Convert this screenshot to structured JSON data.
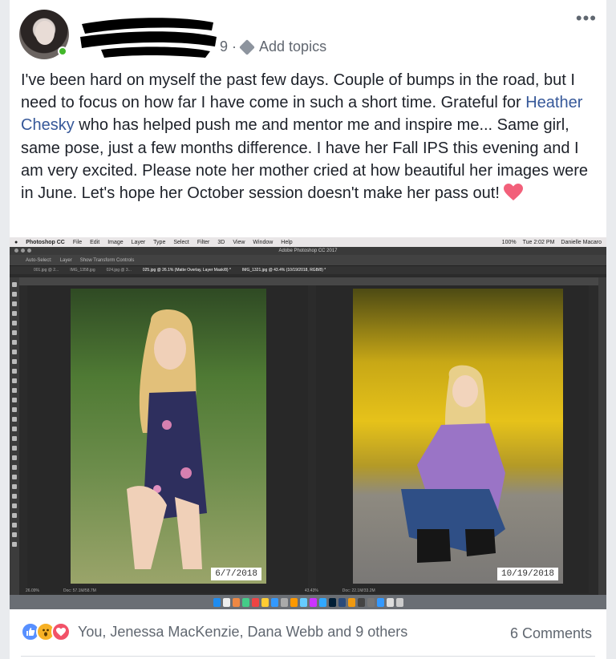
{
  "post": {
    "meta_fragment": "9 ·",
    "add_topics": "Add topics",
    "more": "•••",
    "text_1": "I've been hard on myself the past few days. Couple of bumps in the road, but I need to focus on how far I have come in such a short time. Grateful for ",
    "mention": "Heather Chesky",
    "text_2": " who has helped push me and mentor me and inspire me... Same girl, same pose, just a few months difference. I have her Fall IPS this evening and I am very excited. Please note her mother cried at how beautiful her images were in June. Let's hope her October session doesn't make her pass out! "
  },
  "screenshot": {
    "menu": [
      "Photoshop CC",
      "File",
      "Edit",
      "Image",
      "Layer",
      "Type",
      "Select",
      "Filter",
      "3D",
      "View",
      "Window",
      "Help"
    ],
    "status_right": [
      "100%",
      "Tue 2:02 PM",
      "Danielle Macaro"
    ],
    "window_title": "Adobe Photoshop CC 2017",
    "options": [
      "Auto-Select:",
      "Layer",
      "Show Transform Controls"
    ],
    "tabs": [
      "001.jpg @ 2...",
      "IMG_1358.jpg",
      "024.jpg @ 3...",
      "025.jpg @ 26.1% (Matte Overlay, Layer Mask/8) *",
      "IMG_1321.jpg @ 43.4% (10/19/2018, RGB/8) *"
    ],
    "left_zoom": "26.09%",
    "left_doc": "Doc: 57.1M/58.7M",
    "right_zoom": "43.43%",
    "right_doc": "Doc: 22.1M/33.2M",
    "date_left": "6/7/2018",
    "date_right": "10/19/2018"
  },
  "footer": {
    "reactions_text": "You, Jenessa MacKenzie, Dana Webb and 9 others",
    "comments": "6 Comments"
  },
  "colors": {
    "link": "#365899",
    "like": "#5890ff",
    "wow": "#f7b125",
    "love": "#f25268"
  }
}
